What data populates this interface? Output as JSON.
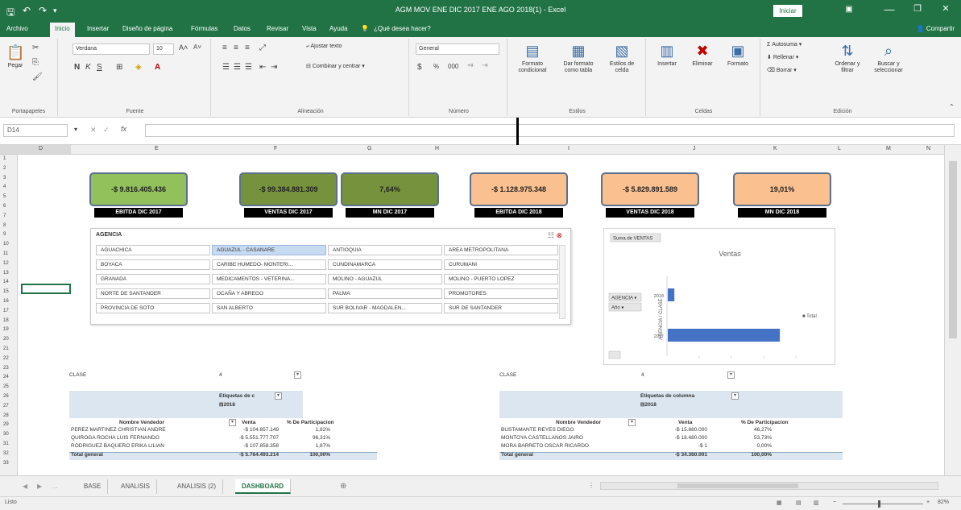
{
  "window": {
    "title": "AGM MOV ENE DIC 2017 ENE AGO 2018(1) - Excel",
    "signin": "Iniciar sesión",
    "minimize": "—",
    "maximize": "❐",
    "close": "✕"
  },
  "ribbon_tabs": [
    "Archivo",
    "Inicio",
    "Insertar",
    "Diseño de página",
    "Fórmulas",
    "Datos",
    "Revisar",
    "Vista",
    "Ayuda",
    "¿Qué desea hacer?"
  ],
  "share": "Compartir",
  "ribbon": {
    "paste": "Pegar",
    "clipboard": "Portapapeles",
    "font_name": "Verdana",
    "font_size": "10",
    "bold": "N",
    "italic": "K",
    "underline": "S",
    "font_group": "Fuente",
    "wrap_text": "Ajustar texto",
    "merge_center": "Combinar y centrar",
    "alignment_group": "Alineación",
    "number_format": "General",
    "number_group": "Número",
    "cond_format": "Formato condicional",
    "format_table": "Dar formato como tabla",
    "cell_styles": "Estilos de celda",
    "styles_group": "Estilos",
    "insert": "Insertar",
    "delete": "Eliminar",
    "format": "Formato",
    "cells_group": "Celdas",
    "autosum": "Autosuma",
    "fill": "Rellenar",
    "clear": "Borrar",
    "sort_filter": "Ordenar y filtrar",
    "find_select": "Buscar y seleccionar",
    "editing_group": "Edición"
  },
  "formula_bar": {
    "name_box": "D14",
    "fx": "fx",
    "value": ""
  },
  "columns": [
    "D",
    "E",
    "F",
    "G",
    "H",
    "I",
    "J",
    "K",
    "L",
    "M",
    "N"
  ],
  "rows": [
    "1",
    "2",
    "3",
    "4",
    "5",
    "6",
    "7",
    "8",
    "9",
    "10",
    "11",
    "12",
    "13",
    "14",
    "15",
    "16",
    "17",
    "18",
    "19",
    "20",
    "21",
    "22",
    "23",
    "24",
    "25",
    "26",
    "27",
    "28",
    "29",
    "30",
    "31",
    "32",
    "33"
  ],
  "kpis": [
    {
      "value": "-$ 9.816.405.436",
      "label": "EBITDA DIC 2017",
      "color": "#92c05b"
    },
    {
      "value": "-$ 99.384.881.309",
      "label": "VENTAS DIC 2017",
      "color": "#76923c"
    },
    {
      "value": "7,64%",
      "label": "MN DIC 2017",
      "color": "#76923c"
    },
    {
      "value": "-$ 1.128.975.348",
      "label": "EBITDA DIC 2018",
      "color": "#fac090"
    },
    {
      "value": "-$ 5.829.891.589",
      "label": "VENTAS DIC 2018",
      "color": "#fac090"
    },
    {
      "value": "19,01%",
      "label": "MN DIC 2018",
      "color": "#fac090"
    }
  ],
  "slicer": {
    "title": "AGENCIA",
    "items": [
      "AGUACHICA",
      "AGUAZUL - CASANARE",
      "ANTIOQUIA",
      "AREA METROPOLITANA",
      "BOYACA",
      "CARIBE HUMEDO- MONTERI...",
      "CUNDINAMARCA",
      "CURUMANI",
      "GRANADA",
      "MEDICAMENTOS - VETERINA...",
      "MOLINO - AGUAZUL",
      "MOLINO - PUERTO LOPEZ",
      "NORTE DE SANTANDER",
      "OCAÑA Y ABREGO",
      "PALMA",
      "PROMOTORES",
      "PROVINCIA DE SOTO",
      "SAN ALBERTO",
      "SUR BOLIVAR - MAGDALEN...",
      "SUR DE SANTANDER"
    ],
    "selected_index": 1
  },
  "chart_data": {
    "type": "bar",
    "title": "Ventas",
    "categories": [
      "2018",
      "2017"
    ],
    "values": [
      5829891589,
      99384881309
    ],
    "legend": "Total",
    "field_buttons": [
      "Suma de VENTAS",
      "AGENCIA",
      "Año"
    ],
    "ylabel": "AGENCIA / CLASE"
  },
  "pivot_left": {
    "filter_label": "CLASE",
    "filter_value": "4",
    "col_label": "Etiquetas de c",
    "year": "2018",
    "headers": [
      "Nombre Vendedor",
      "Venta",
      "% De Participacion"
    ],
    "rows": [
      [
        "PEREZ MARTINEZ CHRISTIAN ANDRE",
        "-$ 104.857.149",
        "1,82%"
      ],
      [
        "QUIROGA ROCHA LUIS FERNANDO",
        "-$ 5.551.777.707",
        "96,31%"
      ],
      [
        "RODRIGUEZ BAQUERO ERIKA LILIAN",
        "-$ 107.858.358",
        "1,87%"
      ]
    ],
    "total": [
      "Total general",
      "-$ 5.764.493.214",
      "100,00%"
    ]
  },
  "pivot_right": {
    "filter_label": "CLASE",
    "filter_value": "4",
    "col_label": "Etiquetas de columna",
    "year": "2018",
    "headers": [
      "Nombre Vendedor",
      "Venta",
      "% De Participacion"
    ],
    "rows": [
      [
        "BUSTAMANTE REYES DIEGO",
        "-$ 15.880.000",
        "46,27%"
      ],
      [
        "MONTOYA CASTELLANOS JAIRO",
        "-$ 18.480.000",
        "53,73%"
      ],
      [
        "MORA BARRETO OSCAR RICARDO",
        "-$ 1",
        "0,00%"
      ]
    ],
    "total": [
      "Total general",
      "-$ 34.360.001",
      "100,00%"
    ]
  },
  "sheet_tabs": [
    "BASE",
    "ANALISIS",
    "ANALISIS (2)",
    "DASHBOARD"
  ],
  "active_sheet": 3,
  "status": {
    "ready": "Listo",
    "zoom": "82%"
  }
}
